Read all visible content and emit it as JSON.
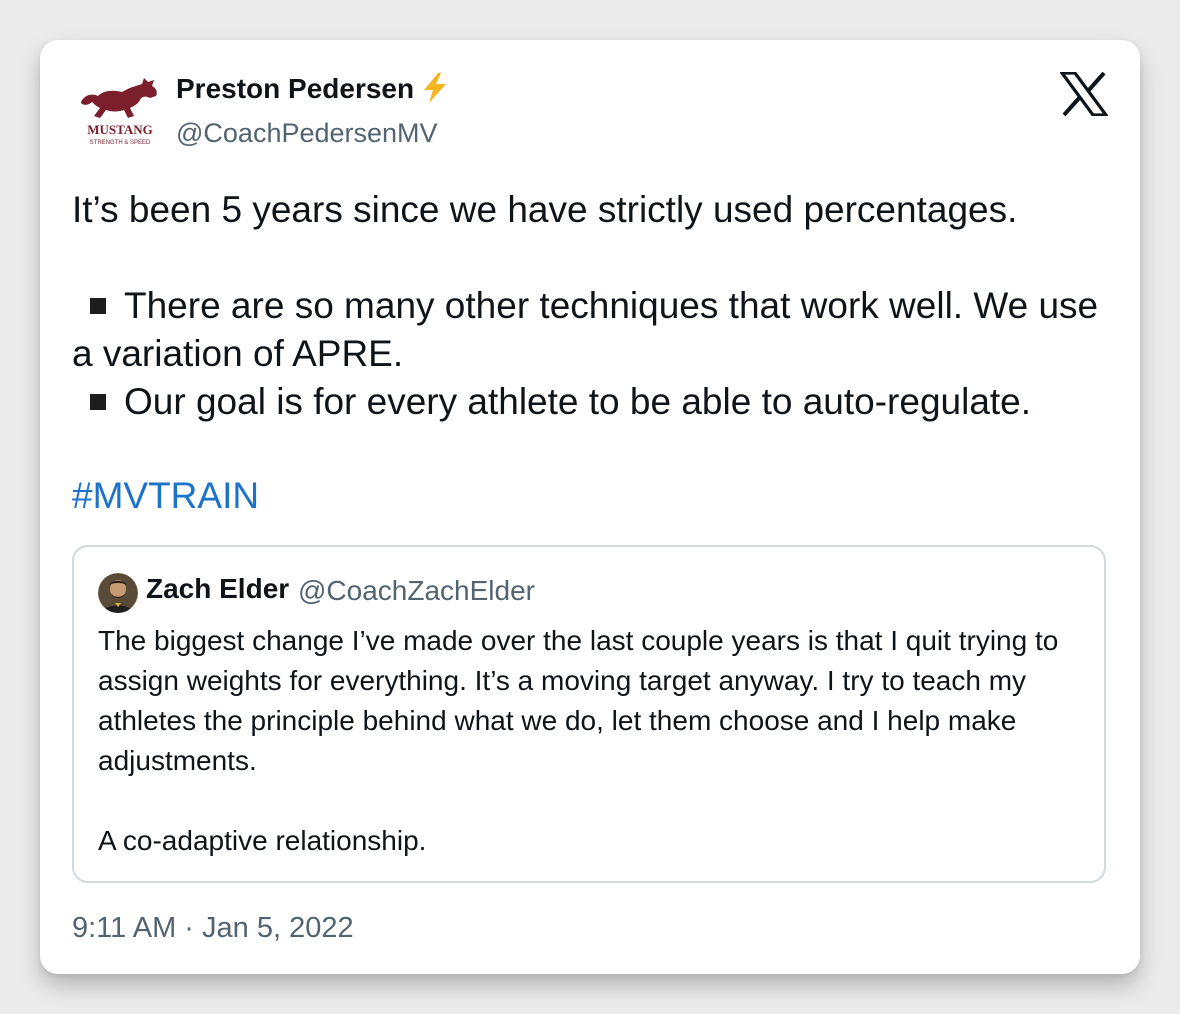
{
  "tweet": {
    "author_name": "Preston Pedersen",
    "author_handle": "@CoachPedersenMV",
    "avatar_icon": "mustang-logo-icon",
    "avatar_text_main": "MUSTANG",
    "avatar_text_sub": "STRENGTH & SPEED",
    "avatar_color": "#7a1f2b",
    "badge_icon": "lightning-bolt-icon",
    "badge_color": "#f5b51e",
    "platform_icon": "x-logo-icon",
    "text_line1": "It’s been 5 years since we have strictly used percentages.",
    "bullet1": "There are so many other techniques that work well. We use a variation of APRE.",
    "bullet2": "Our goal is for every athlete to be able to auto-regulate.",
    "hashtag": "#MVTRAIN",
    "hashtag_color": "#1d72c9",
    "timestamp": "9:11 AM · Jan 5, 2022"
  },
  "quoted_tweet": {
    "author_name": "Zach Elder",
    "author_handle": "@CoachZachElder",
    "avatar_icon": "profile-photo-avatar",
    "paragraph1": "The biggest change I’ve made over the last couple years is that I quit trying to assign weights for everything. It’s a moving target anyway. I try to teach my athletes the principle behind what we do, let them choose and I help make adjustments.",
    "paragraph2": "A co-adaptive relationship."
  }
}
